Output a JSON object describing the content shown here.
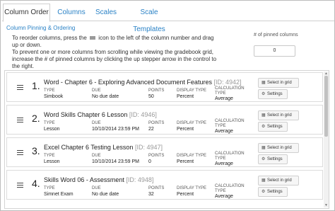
{
  "tabs": [
    {
      "label": "Column Order",
      "active": true
    },
    {
      "label": "Columns",
      "active": false
    },
    {
      "label": "Scales",
      "active": false
    },
    {
      "label": "Scale Templates",
      "active": false
    }
  ],
  "section_title": "Column Pinning & Ordering",
  "instructions": {
    "line1_pre": "To reorder columns, press the",
    "line1_post": "icon to the left of the column number and drag up or down.",
    "line2": "To prevent one or more columns from scrolling while viewing the gradebook grid, increase the # of pinned columns by clicking the up stepper arrow in the control to the right."
  },
  "pinned": {
    "label": "# of pinned columns",
    "value": "0"
  },
  "field_labels": {
    "type": "TYPE",
    "due": "DUE",
    "points": "POINTS",
    "display_type_line1": "DISPLAY TYPE",
    "calc_line1": "CALCULATION",
    "calc_line2": "TYPE"
  },
  "buttons": {
    "select": "Select in grid",
    "settings": "Settings"
  },
  "rows": [
    {
      "num": "1.",
      "title": "Word - Chapter 6 - Exploring Advanced Document Features",
      "id": "[ID: 4942]",
      "type": "Simbook",
      "due": "No due date",
      "points": "50",
      "display": "Percent",
      "calc": "Average"
    },
    {
      "num": "2.",
      "title": "Word Skills Chapter 6 Lesson",
      "id": "[ID: 4946]",
      "type": "Lesson",
      "due": "10/10/2014 23:59 PM",
      "points": "22",
      "display": "Percent",
      "calc": "Average"
    },
    {
      "num": "3.",
      "title": "Excel Chapter 6 Testing Lesson",
      "id": "[ID: 4947]",
      "type": "Lesson",
      "due": "10/10/2014 23:59 PM",
      "points": "0",
      "display": "Percent",
      "calc": "Average"
    },
    {
      "num": "4.",
      "title": "Skills Word 06 - Assessment",
      "id": "[ID: 4948]",
      "type": "Simnet Exam",
      "due": "No due date",
      "points": "32",
      "display": "Percent",
      "calc": "Average"
    }
  ]
}
